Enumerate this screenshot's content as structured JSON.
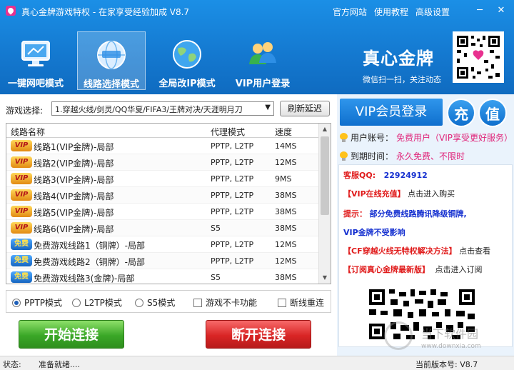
{
  "window": {
    "title": "真心金牌游戏特权 - 在家享受经验加成 V8.7",
    "links": [
      "官方网站",
      "使用教程",
      "高级设置"
    ],
    "min_glyph": "─",
    "close_glyph": "✕"
  },
  "modes": [
    {
      "label": "一键网吧模式",
      "icon": "monitor-icon",
      "active": false
    },
    {
      "label": "线路选择模式",
      "icon": "globe-network-icon",
      "active": true
    },
    {
      "label": "全局改IP模式",
      "icon": "globe-icon",
      "active": false
    },
    {
      "label": "VIP用户登录",
      "icon": "users-icon",
      "active": false
    }
  ],
  "brand": {
    "title": "真心金牌",
    "subtitle": "微信扫一扫，关注动态"
  },
  "game": {
    "label": "游戏选择:",
    "selected": "1.穿越火线/剑灵/QQ华夏/FIFA3/王牌对决/天涯明月刀",
    "refresh": "刷新延迟"
  },
  "table": {
    "headers": [
      "线路名称",
      "代理模式",
      "速度"
    ],
    "rows": [
      {
        "badge": "VIP",
        "type": "vip",
        "name": "线路1(VIP金牌)-局部",
        "mode": "PPTP, L2TP",
        "speed": "14MS"
      },
      {
        "badge": "VIP",
        "type": "vip",
        "name": "线路2(VIP金牌)-局部",
        "mode": "PPTP, L2TP",
        "speed": "12MS"
      },
      {
        "badge": "VIP",
        "type": "vip",
        "name": "线路3(VIP金牌)-局部",
        "mode": "PPTP, L2TP",
        "speed": "9MS"
      },
      {
        "badge": "VIP",
        "type": "vip",
        "name": "线路4(VIP金牌)-局部",
        "mode": "PPTP, L2TP",
        "speed": "38MS"
      },
      {
        "badge": "VIP",
        "type": "vip",
        "name": "线路5(VIP金牌)-局部",
        "mode": "PPTP, L2TP",
        "speed": "38MS"
      },
      {
        "badge": "VIP",
        "type": "vip",
        "name": "线路6(VIP金牌)-局部",
        "mode": "S5",
        "speed": "38MS"
      },
      {
        "badge": "免费",
        "type": "free",
        "name": "免费游戏线路1（铜牌）-局部",
        "mode": "PPTP, L2TP",
        "speed": "12MS"
      },
      {
        "badge": "免费",
        "type": "free",
        "name": "免费游戏线路2（铜牌）-局部",
        "mode": "PPTP, L2TP",
        "speed": "12MS"
      },
      {
        "badge": "免费",
        "type": "free",
        "name": "免费游戏线路3(金牌)-局部",
        "mode": "S5",
        "speed": "38MS"
      }
    ]
  },
  "options": {
    "pptp": "PPTP模式",
    "l2tp": "L2TP模式",
    "s5": "S5模式",
    "nolag": "游戏不卡功能",
    "reconnect": "断线重连",
    "selected": "pptp"
  },
  "buttons": {
    "start": "开始连接",
    "stop": "断开连接"
  },
  "right": {
    "vip_login": "VIP会员登录",
    "charge": "充",
    "value": "值",
    "account_label": "用户账号：",
    "account_value": "免费用户（VIP享受更好服务）",
    "expire_label": "到期时间：",
    "expire_value": "永久免费、不限时",
    "qq_label": "客服QQ:",
    "qq_value": "22924912",
    "recharge_link": "【VIP在线充值】",
    "recharge_text": "点击进入购买",
    "tip_label": "提示：",
    "tip_text": "部分免费线路腾讯降级铜牌,",
    "tip_text2": "VIP金牌不受影响",
    "cf_link": "【CF穿越火线无特权解决方法】",
    "cf_text": "点击查看",
    "subscribe_link": "【订阅真心金牌最新版】",
    "subscribe_text": "点击进入订阅"
  },
  "status": {
    "label": "状态:",
    "text": "准备就绪....",
    "version": "当前版本号: V8.7"
  },
  "watermark": {
    "title": "当下软件园",
    "url": "www.downxia.com"
  },
  "colors": {
    "header": "#1478cf",
    "accent_red": "#e01b1b",
    "accent_pink": "#e0257a",
    "start_green": "#3aa727",
    "stop_red": "#d92525"
  }
}
